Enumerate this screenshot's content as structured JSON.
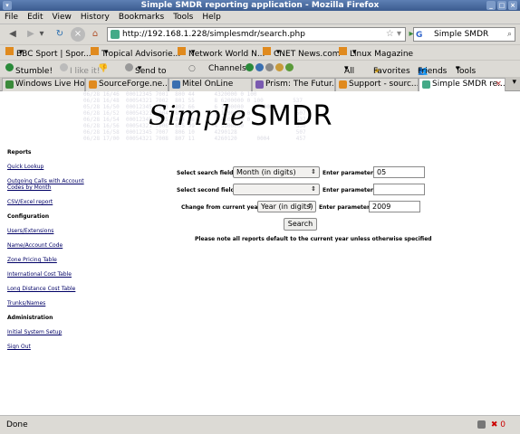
{
  "window": {
    "title": "Simple SMDR reporting application - Mozilla Firefox"
  },
  "menu": [
    "File",
    "Edit",
    "View",
    "History",
    "Bookmarks",
    "Tools",
    "Help"
  ],
  "nav": {
    "url": "http://192.168.1.228/simplesmdr/search.php",
    "search_value": "Simple SMDR",
    "search_engine_icon": "G"
  },
  "bookmarks": [
    "BBC Sport | Spor...",
    "Tropical Advisorie...",
    "Network World N...",
    "CNET News.com",
    "Linux Magazine"
  ],
  "toolbar2": {
    "stumble": "Stumble!",
    "ilike": "I like it!",
    "sendto": "Send to",
    "channels": "Channels:",
    "all": "All",
    "favorites": "Favorites",
    "friends": "Friends",
    "tools": "Tools"
  },
  "tabs": [
    {
      "label": "Windows Live Ho..."
    },
    {
      "label": "SourceForge.ne..."
    },
    {
      "label": "Mitel OnLine"
    },
    {
      "label": "Prism: The Futur..."
    },
    {
      "label": "Support - sourc..."
    },
    {
      "label": "Simple SMDR re..."
    }
  ],
  "logo": {
    "part1": "Simple",
    "part2": "SMDR"
  },
  "sidebar": {
    "reports_heading": "Reports",
    "reports": [
      "Quick Lookup",
      "Outgoing Calls with Account Codes by Month",
      "CSV/Excel report"
    ],
    "config_heading": "Configuration",
    "config": [
      "Users/Extensions",
      "Name/Account Code",
      "Zone Pricing Table",
      "International Cost Table",
      "Long Distance Cost Table",
      "Trunks/Names"
    ],
    "admin_heading": "Administration",
    "admin": [
      "Initial System Setup",
      "Sign Out"
    ]
  },
  "form": {
    "search_field_label": "Select search field:",
    "search_field_value": "Month (in digits)",
    "enter_param_label": "Enter parameter:",
    "param1": "05",
    "second_field_label": "Select second field:",
    "second_field_value": "",
    "param2": "",
    "year_label": "Change from current year:",
    "year_value": "Year (in digits)",
    "param3": "2009",
    "search_button": "Search",
    "note": "Please note all reports default to the current year unless otherwise specified"
  },
  "status": {
    "text": "Done",
    "errors": "0"
  }
}
